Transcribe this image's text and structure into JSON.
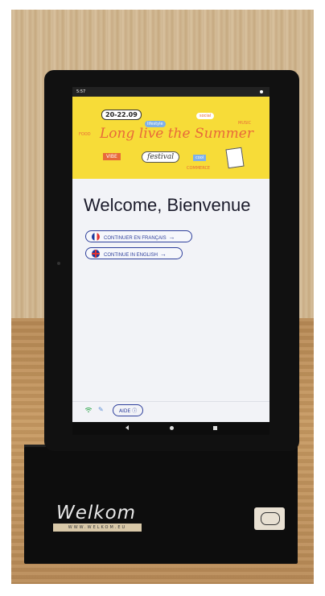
{
  "screen": {
    "status_time": "5:57",
    "banner": {
      "date": "20-22.09",
      "title": "Long live the Summer",
      "tags": [
        "lifestyle",
        "social",
        "FOOD",
        "MUSIC",
        "VIBE",
        "festival",
        "cool",
        "COMMERCE"
      ]
    },
    "heading": "Welcome, Bienvenue",
    "buttons": {
      "french": "CONTINUER EN FRANÇAIS",
      "english": "CONTINUE IN ENGLISH"
    },
    "footer": {
      "help_label": "AIDE"
    }
  },
  "stand": {
    "brand": "Welkom",
    "website": "WWW.WELKOM.EU"
  },
  "colors": {
    "banner_bg": "#f7dc38",
    "accent": "#2e3f9b",
    "banner_text": "#e86a3a"
  }
}
